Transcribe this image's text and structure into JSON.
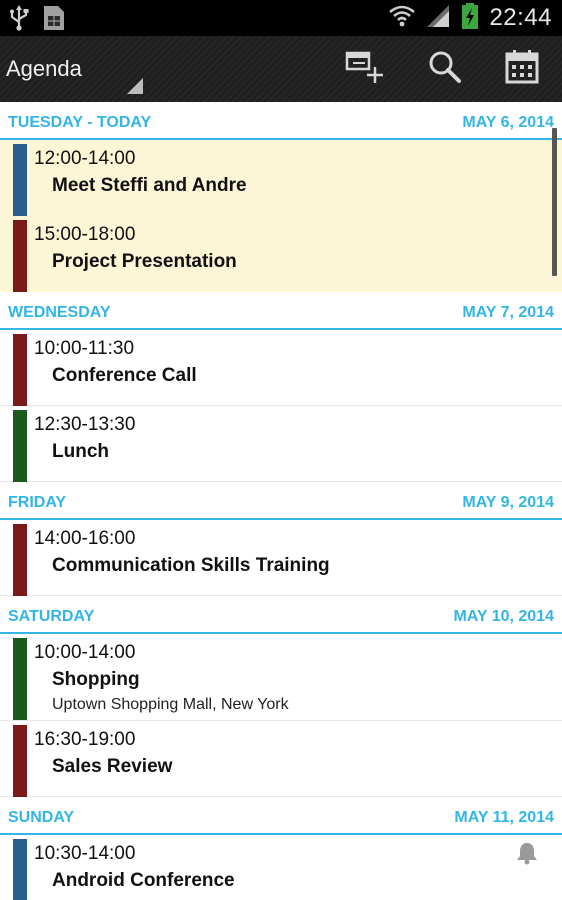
{
  "status_bar": {
    "time": "22:44",
    "icons": [
      "usb-icon",
      "sim-card-icon",
      "wifi-icon",
      "signal-icon",
      "battery-charging-icon"
    ]
  },
  "action_bar": {
    "title": "Agenda",
    "actions": [
      "add-event-icon",
      "search-icon",
      "calendar-icon"
    ]
  },
  "colors": {
    "accent": "#33b5e5",
    "today_bg": "#fcf5d6",
    "blue": "#2c5d8f",
    "red": "#7b1a1a",
    "green": "#1a5a1a"
  },
  "days": [
    {
      "name": "TUESDAY - TODAY",
      "date": "MAY 6, 2014",
      "events": [
        {
          "time": "12:00-14:00",
          "title": "Meet Steffi and Andre",
          "color": "#2c5d8f"
        },
        {
          "time": "15:00-18:00",
          "title": "Project Presentation",
          "color": "#7b1a1a"
        }
      ]
    },
    {
      "name": "WEDNESDAY",
      "date": "MAY 7, 2014",
      "events": [
        {
          "time": "10:00-11:30",
          "title": "Conference Call",
          "color": "#7b1a1a"
        },
        {
          "time": "12:30-13:30",
          "title": "Lunch",
          "color": "#1a5a1a"
        }
      ]
    },
    {
      "name": "FRIDAY",
      "date": "MAY 9, 2014",
      "events": [
        {
          "time": "14:00-16:00",
          "title": "Communication Skills Training",
          "color": "#7b1a1a"
        }
      ]
    },
    {
      "name": "SATURDAY",
      "date": "MAY 10, 2014",
      "events": [
        {
          "time": "10:00-14:00",
          "title": "Shopping",
          "location": "Uptown Shopping Mall, New York",
          "color": "#1a5a1a"
        },
        {
          "time": "16:30-19:00",
          "title": "Sales Review",
          "color": "#7b1a1a"
        }
      ]
    },
    {
      "name": "SUNDAY",
      "date": "MAY 11, 2014",
      "events": [
        {
          "time": "10:30-14:00",
          "title": "Android Conference",
          "color": "#2c5d8f",
          "reminder": "bell-icon"
        }
      ]
    }
  ]
}
